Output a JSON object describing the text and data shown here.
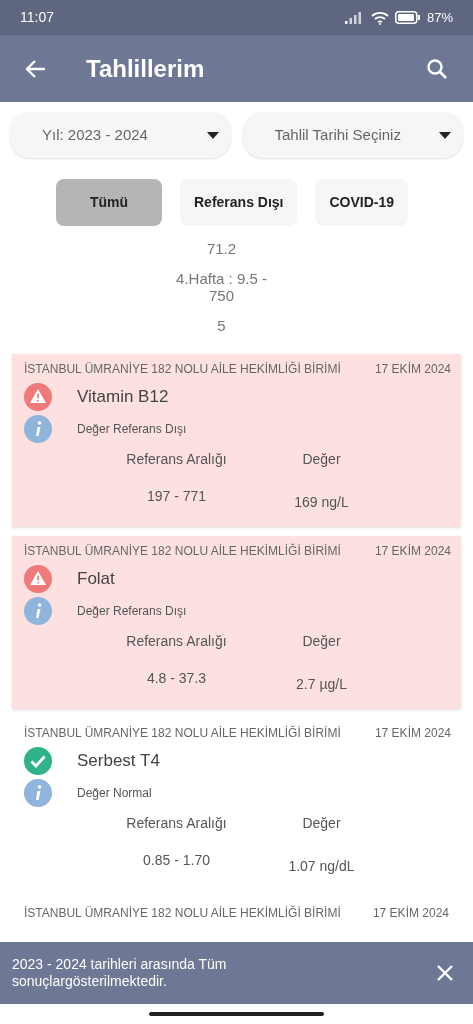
{
  "status_bar": {
    "time": "11:07",
    "battery": "87%"
  },
  "app_bar": {
    "title": "Tahlillerim"
  },
  "filters": [
    {
      "value": "Yıl: 2023 - 2024"
    },
    {
      "value": "Tahlil Tarihi Seçiniz"
    }
  ],
  "tabs": [
    {
      "label": "Tümü",
      "selected": true
    },
    {
      "label": "Referans Dışı",
      "selected": false
    },
    {
      "label": "COVID-19",
      "selected": false
    }
  ],
  "previous_reference_lines": [
    "71.2",
    "4.Hafta  :  9.5 -\n750",
    "5"
  ],
  "results": [
    {
      "institution": "İSTANBUL ÜMRANİYE 182 NOLU AİLE HEKİMLİĞİ BİRİMİ",
      "date": "17 EKİM 2024",
      "kind": "out_of_range",
      "name": "Vitamin B12",
      "status": "Değer Referans Dışı",
      "range_label": "Referans Aralığı",
      "value_label": "Değer",
      "range": "197 - 771",
      "value": "169 ng/L"
    },
    {
      "institution": "İSTANBUL ÜMRANİYE 182 NOLU AİLE HEKİMLİĞİ BİRİMİ",
      "date": "17 EKİM 2024",
      "kind": "out_of_range",
      "name": "Folat",
      "status": "Değer Referans Dışı",
      "range_label": "Referans Aralığı",
      "value_label": "Değer",
      "range": "4.8 - 37.3",
      "value": "2.7 µg/L"
    },
    {
      "institution": "İSTANBUL ÜMRANİYE 182 NOLU AİLE HEKİMLİĞİ BİRİMİ",
      "date": "17 EKİM 2024",
      "kind": "normal",
      "name": "Serbest T4",
      "status": "Değer Normal",
      "range_label": "Referans Aralığı",
      "value_label": "Değer",
      "range": "0.85 - 1.70",
      "value": "1.07 ng/dL"
    }
  ],
  "partial_result": {
    "institution": "İSTANBUL ÜMRANİYE 182 NOLU AİLE HEKİMLİĞİ BİRİMİ",
    "date": "17 EKİM 2024"
  },
  "snackbar": {
    "message": "2023 - 2024 tarihleri arasında Tüm\nsonuçlargösterilmektedir."
  }
}
